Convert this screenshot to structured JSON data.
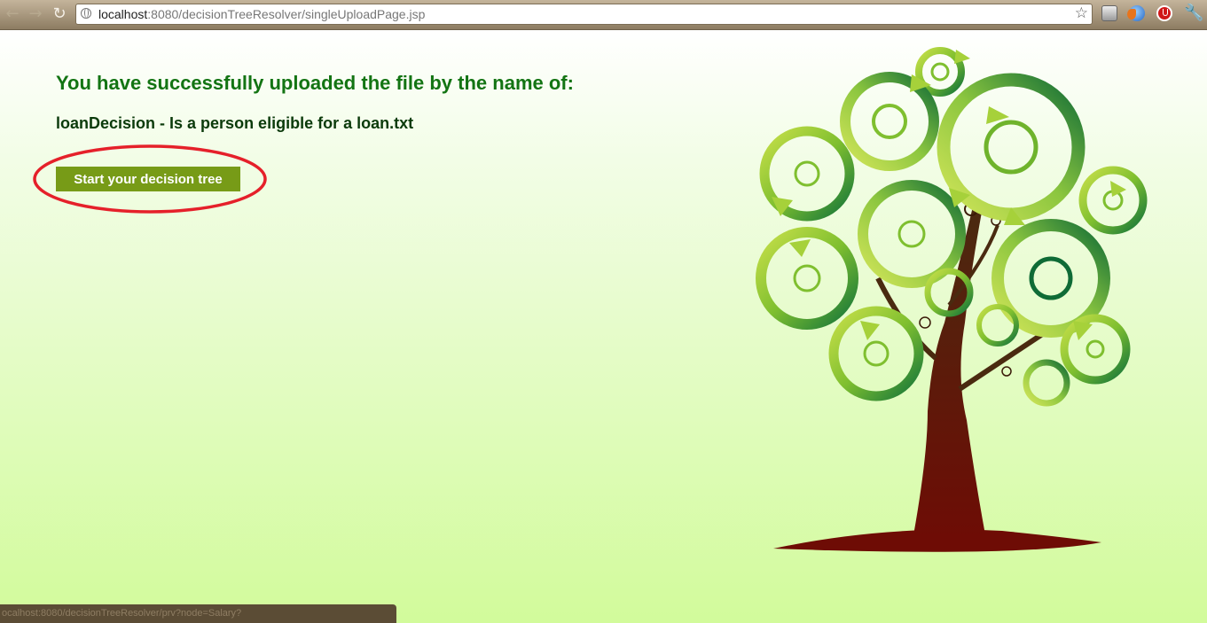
{
  "browser": {
    "url_host": "localhost",
    "url_rest": ":8080/decisionTreeResolver/singleUploadPage.jsp",
    "back_icon": "←",
    "forward_icon": "→",
    "reload_icon": "↻",
    "star_icon": "☆",
    "wrench_icon": "🔧"
  },
  "page": {
    "heading": "You have successfully uploaded the file by the name of:",
    "filename": "loanDecision - Is a person eligible for a loan.txt",
    "start_button_label": "Start your decision tree"
  },
  "status": {
    "link_text": "ocalhost:8080/decisionTreeResolver/prv?node=Salary?"
  },
  "colors": {
    "heading": "#137413",
    "button": "#779b17",
    "highlight": "#e5202a",
    "trunk": "#5a1207"
  }
}
